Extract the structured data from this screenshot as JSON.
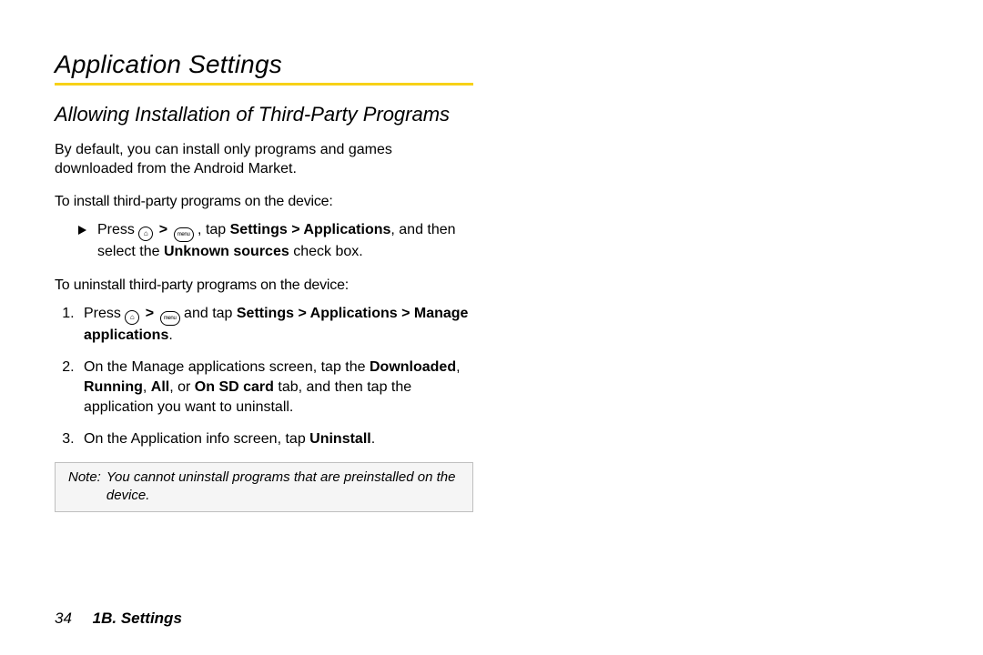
{
  "title": "Application Settings",
  "subsection": "Allowing Installation of Third-Party Programs",
  "intro": "By default, you can install only programs and games downloaded from the Android Market.",
  "install_lead": "To install third-party programs on the device:",
  "install_step_prefix": "Press ",
  "install_step_mid": ", tap ",
  "install_step_path": "Settings > Applications",
  "install_step_suffix_a": ", and then select the ",
  "install_step_bold": "Unknown sources",
  "install_step_suffix_b": " check box.",
  "uninstall_lead": "To uninstall third-party programs on the device:",
  "u_step1_a": "Press ",
  "u_step1_b": " and tap ",
  "u_step1_path": "Settings > Applications > Manage applications",
  "u_step1_c": ".",
  "u_step2_a": "On the Manage applications screen, tap the ",
  "u_step2_tabs": "Downloaded",
  "u_step2_sep1": ", ",
  "u_step2_tab2": "Running",
  "u_step2_sep2": ", ",
  "u_step2_tab3": "All",
  "u_step2_sep3": ", or ",
  "u_step2_tab4": "On SD card",
  "u_step2_b": " tab, and then tap the application you want to uninstall.",
  "u_step3_a": "On the Application info screen, tap ",
  "u_step3_bold": "Uninstall",
  "u_step3_b": ".",
  "note_label": "Note:",
  "note_text": "You cannot uninstall programs that are preinstalled on the device.",
  "page_number": "34",
  "chapter": "1B. Settings",
  "gt": ">",
  "home_glyph": "⌂",
  "menu_glyph": "menu"
}
